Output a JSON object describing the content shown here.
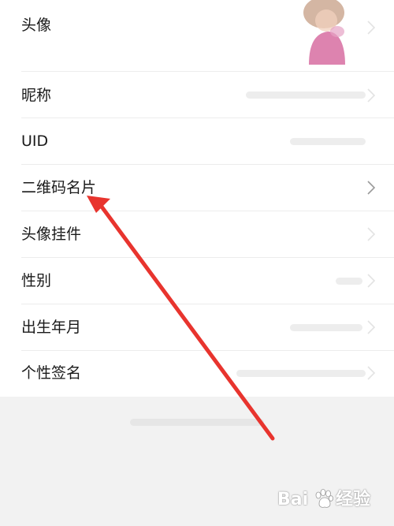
{
  "rows": [
    {
      "key": "avatar",
      "label": "头像"
    },
    {
      "key": "nickname",
      "label": "昵称"
    },
    {
      "key": "uid",
      "label": "UID"
    },
    {
      "key": "qrcode",
      "label": "二维码名片"
    },
    {
      "key": "pendant",
      "label": "头像挂件"
    },
    {
      "key": "gender",
      "label": "性别"
    },
    {
      "key": "birthday",
      "label": "出生年月"
    },
    {
      "key": "signature",
      "label": "个性签名"
    }
  ],
  "watermark": {
    "left": "Bai",
    "right": "经验"
  },
  "colors": {
    "page_background": "#f2f2f2",
    "card_background": "#ffffff",
    "label_text": "#1a1a1a",
    "annotation_arrow": "#e8342e"
  },
  "icons": [
    "chevron-right-icon",
    "avatar-image",
    "annotation-arrow",
    "baidu-paw-icon"
  ]
}
